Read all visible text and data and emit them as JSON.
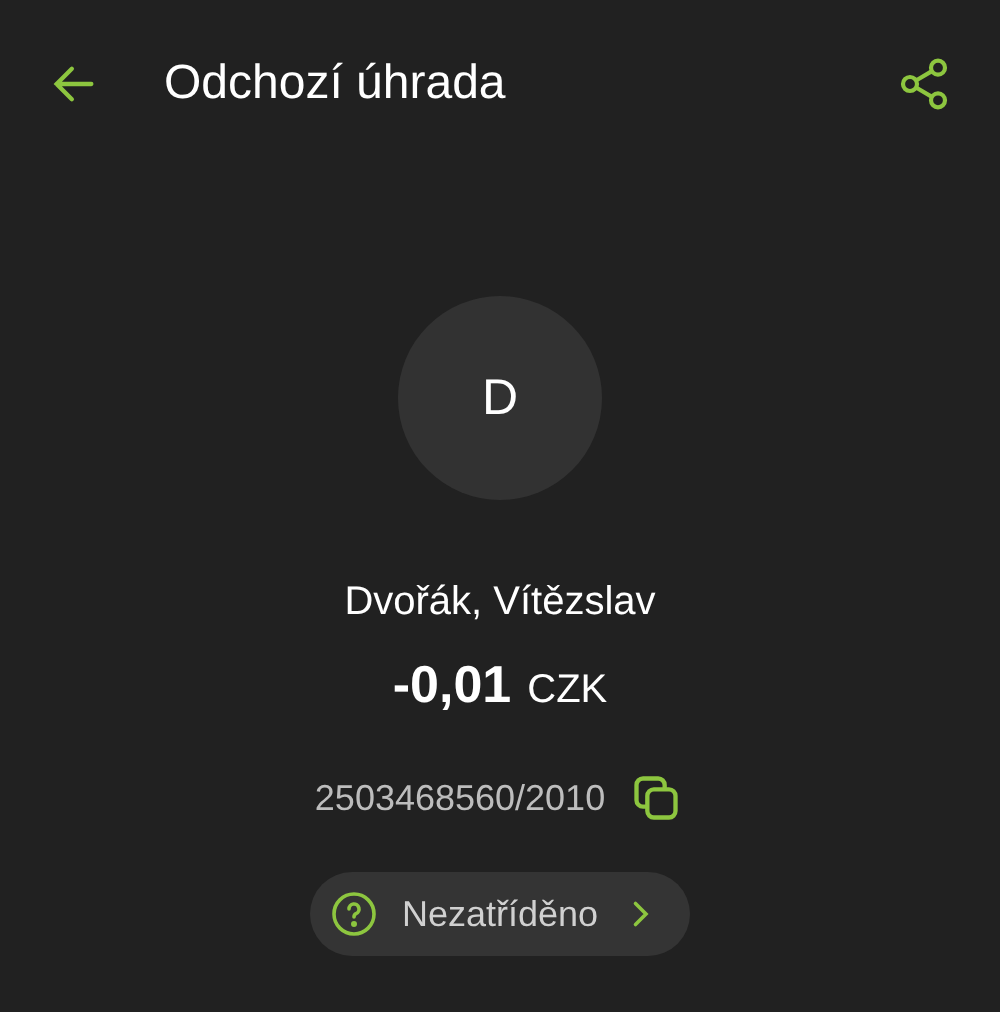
{
  "header": {
    "title": "Odchozí úhrada"
  },
  "contact": {
    "initial": "D",
    "name": "Dvořák, Vítězslav"
  },
  "amount": {
    "value": "-0,01",
    "currency": "CZK"
  },
  "account": {
    "number": "2503468560/2010"
  },
  "category": {
    "label": "Nezatříděno"
  }
}
